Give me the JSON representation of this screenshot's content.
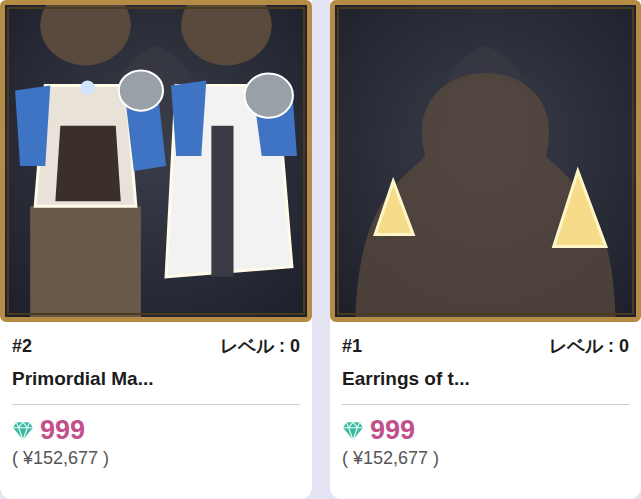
{
  "items": [
    {
      "kind": "outfit",
      "rank": "#2",
      "level": "レベル : 0",
      "name": "Primordial Ma...",
      "price": "999",
      "price_yen": "( ¥152,677 )"
    },
    {
      "kind": "earrings",
      "rank": "#1",
      "level": "レベル : 0",
      "name": "Earrings of t...",
      "price": "999",
      "price_yen": "( ¥152,677 )"
    }
  ]
}
